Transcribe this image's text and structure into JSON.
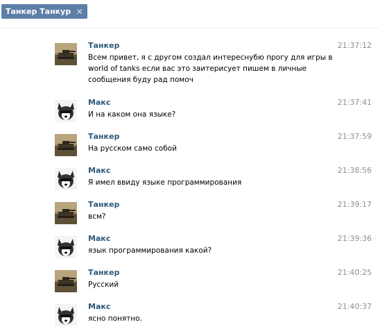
{
  "header": {
    "chip_label": "Танкер Танкур",
    "chip_close_glyph": "✕"
  },
  "messages": [
    {
      "author": "Танкер",
      "time": "21:37:12",
      "text": "Всем привет, я с другом создал интереснубю прогу для игры в world of tanks если вас это заитерисует пишем в личные сообщения буду рад помоч",
      "avatar": "tank-avatar"
    },
    {
      "author": "Макс",
      "time": "21:37:41",
      "text": "И на каком она языке?",
      "avatar": "husky-avatar"
    },
    {
      "author": "Танкер",
      "time": "21:37:59",
      "text": "На русском само собой",
      "avatar": "tank-avatar"
    },
    {
      "author": "Макс",
      "time": "21:38:56",
      "text": "Я имел ввиду языке программирования",
      "avatar": "husky-avatar"
    },
    {
      "author": "Танкер",
      "time": "21:39:17",
      "text": "всм?",
      "avatar": "tank-avatar"
    },
    {
      "author": "Макс",
      "time": "21:39:36",
      "text": "язык программирования какой?",
      "avatar": "husky-avatar"
    },
    {
      "author": "Танкер",
      "time": "21:40:25",
      "text": "Русский",
      "avatar": "tank-avatar"
    },
    {
      "author": "Макс",
      "time": "21:40:37",
      "text": "ясно понятно.",
      "avatar": "husky-avatar"
    }
  ],
  "colors": {
    "chip_bg": "#5b7fa6",
    "author": "#2b587a",
    "time": "#8e8e8e"
  }
}
